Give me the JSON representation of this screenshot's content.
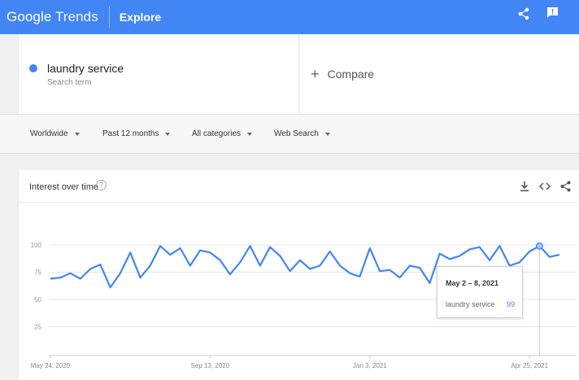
{
  "header": {
    "logo_google": "Google",
    "logo_trends": "Trends",
    "page_title": "Explore",
    "icons": [
      "share-icon",
      "feedback-icon"
    ],
    "color": "#4285f4"
  },
  "search": {
    "term": "laundry service",
    "term_sublabel": "Search term",
    "term_color": "#4285f4",
    "compare_label": "Compare"
  },
  "filters": {
    "location": "Worldwide",
    "time_range": "Past 12 months",
    "category": "All categories",
    "property": "Web Search"
  },
  "card": {
    "title": "Interest over time",
    "icons": [
      "help-icon",
      "download-icon",
      "embed-icon",
      "share-icon"
    ]
  },
  "tooltip": {
    "date": "May 2 – 8, 2021",
    "series": "laundry service",
    "value": "99"
  },
  "chart_data": {
    "type": "line",
    "series": [
      {
        "name": "laundry service",
        "color": "#4285f4",
        "values": [
          69,
          70,
          74,
          69,
          78,
          82,
          61,
          74,
          93,
          70,
          81,
          99,
          91,
          97,
          81,
          95,
          93,
          86,
          73,
          84,
          99,
          81,
          98,
          90,
          76,
          86,
          78,
          81,
          94,
          81,
          74,
          71,
          97,
          76,
          77,
          70,
          81,
          79,
          65,
          92,
          87,
          90,
          96,
          98,
          86,
          99,
          81,
          84,
          94,
          99,
          89,
          91
        ]
      }
    ],
    "yticks": [
      25,
      50,
      75,
      100
    ],
    "ylim": [
      0,
      100
    ],
    "xtick_labels": [
      "May 24, 2020",
      "Sep 13, 2020",
      "Jan 3, 2021",
      "Apr 25, 2021"
    ],
    "xtick_indices": [
      0,
      16,
      32,
      48
    ],
    "highlight_index": 49,
    "grid": true
  }
}
